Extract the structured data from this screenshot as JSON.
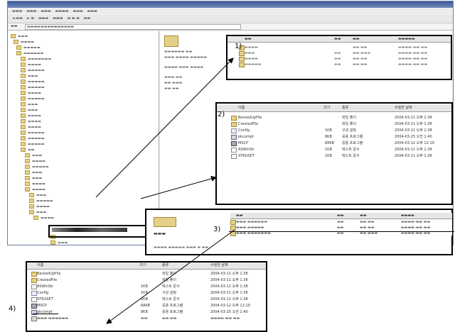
{
  "labels": {
    "c1": "1)",
    "c2": "2)",
    "c3": "3)",
    "c4": "4)"
  },
  "callout2": {
    "headers": [
      "이름",
      "크기",
      "종류",
      "수정한 날짜"
    ],
    "rows": [
      {
        "name": "BackedUpFile",
        "size": "",
        "type": "파일 폴더",
        "date": "2004-03-11 오후 1:38"
      },
      {
        "name": "CreatedFile",
        "size": "",
        "type": "파일 폴더",
        "date": "2004-03-11 오후 1:38"
      },
      {
        "name": "Config",
        "size": "1KB",
        "type": "구성 설정",
        "date": "2004-03-11 오후 1:38"
      },
      {
        "name": "pkcompt",
        "size": "8KB",
        "type": "응용 프로그램",
        "date": "2004-03-25 오전 1:40"
      },
      {
        "name": "MSCP",
        "size": "68KB",
        "type": "응용 프로그램",
        "date": "2004-03-12 오후 12:19"
      },
      {
        "name": "ASWinStr",
        "size": "1KB",
        "type": "텍스트 문서",
        "date": "2004-03-11 오후 1:38"
      },
      {
        "name": "STRUSET",
        "size": "1KB",
        "type": "텍스트 문서",
        "date": "2004-03-11 오후 1:38"
      }
    ]
  },
  "callout4": {
    "headers": [
      "이름",
      "크기",
      "종류",
      "수정한 날짜"
    ],
    "rows": [
      {
        "name": "BackedUpFile",
        "size": "",
        "type": "파일 폴더",
        "date": "2004-03-11 오후 1:38"
      },
      {
        "name": "CreatedFile",
        "size": "",
        "type": "파일 폴더",
        "date": "2004-03-11 오후 1:38"
      },
      {
        "name": "ASWinStr",
        "size": "1KB",
        "type": "텍스트 문서",
        "date": "2004-03-11 오후 1:38"
      },
      {
        "name": "Config",
        "size": "1KB",
        "type": "구성 설정",
        "date": "2004-03-11 오후 1:38"
      },
      {
        "name": "STRUSET",
        "size": "1KB",
        "type": "텍스트 문서",
        "date": "2004-03-11 오후 1:38"
      },
      {
        "name": "MSCP",
        "size": "68KB",
        "type": "응용 프로그램",
        "date": "2004-03-12 오후 12:19"
      },
      {
        "name": "pkcompt",
        "size": "8KB",
        "type": "응용 프로그램",
        "date": "2004-03-25 오전 1:40"
      }
    ]
  },
  "colors": {
    "callout_border": "#000000",
    "titlebar": "#3a5a9a",
    "folder": "#e5d08a"
  }
}
